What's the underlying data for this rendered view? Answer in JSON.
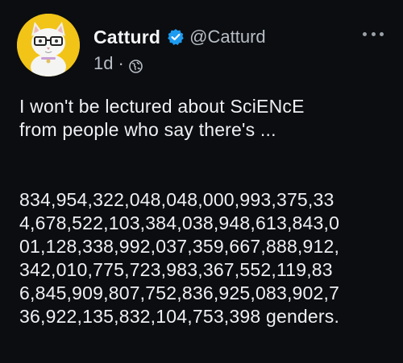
{
  "post": {
    "author_name": "Catturd",
    "handle": "@Catturd",
    "time": "1d",
    "separator": "·",
    "visibility_icon": "globe-icon",
    "verified_icon": "verified-badge-icon",
    "more_icon": "more-horizontal-icon",
    "avatar": "cat-with-glasses-avatar",
    "text_line_1": "I won't be lectured about SciENcE",
    "text_line_2": "from people who say there's ...",
    "number_lines": [
      "834,954,322,048,048,000,993,375,33",
      "4,678,522,103,384,038,948,613,843,0",
      "01,128,338,992,037,359,667,888,912,",
      "342,010,775,723,983,367,552,119,83",
      "6,845,909,807,752,836,925,083,902,7",
      "36,922,135,832,104,753,398 genders."
    ]
  },
  "colors": {
    "background": "#0b0d10",
    "text": "#eef0f3",
    "muted": "#b8bec6",
    "verified": "#1d9bf0",
    "avatar_bg": "#f1c417"
  }
}
